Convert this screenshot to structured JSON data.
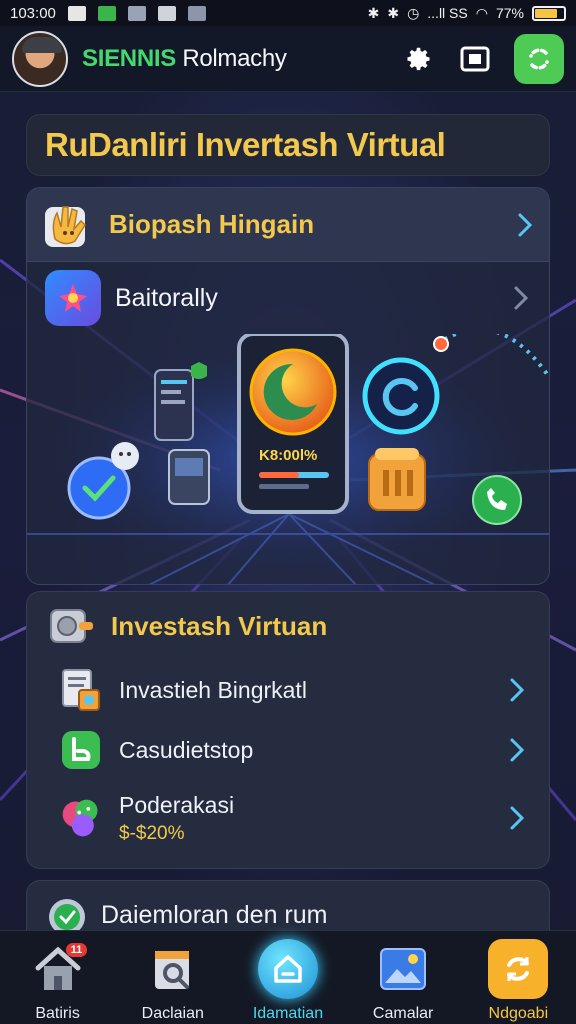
{
  "status_bar": {
    "time": "103:00",
    "signal_text": "...ll SS",
    "battery_pct": "77%",
    "battery_level": 0.77
  },
  "header": {
    "title_accent": "SIENNIS",
    "title_rest": "Rolmachy",
    "icons": [
      "settings-icon",
      "screen-icon",
      "refresh-icon"
    ]
  },
  "page_title": "RuDanliri Invertash Virtual",
  "main_card": {
    "head_label": "Biopash Hingain",
    "sub_label": "Baitorally",
    "phone_value": "K8:00l%"
  },
  "invest_card": {
    "title": "Investash Virtuan",
    "items": [
      {
        "label": "Invastieh Bingrkatl",
        "sub": ""
      },
      {
        "label": "Casudietstop",
        "sub": ""
      },
      {
        "label": "Poderakasi",
        "sub": "$-$20%"
      }
    ]
  },
  "partial_card": {
    "label": "Daiemloran den rum"
  },
  "bottom_nav": {
    "items": [
      {
        "label": "Batiris",
        "badge": "11"
      },
      {
        "label": "Daclaian",
        "badge": ""
      },
      {
        "label": "Idamatian",
        "badge": ""
      },
      {
        "label": "Camalar",
        "badge": ""
      },
      {
        "label": "Ndgoabi",
        "badge": ""
      }
    ],
    "active_index": 2
  },
  "colors": {
    "accent_yellow": "#f2c94c",
    "accent_green": "#45d86e",
    "active_cyan": "#4ed8f0",
    "bg": "#141a2e"
  }
}
